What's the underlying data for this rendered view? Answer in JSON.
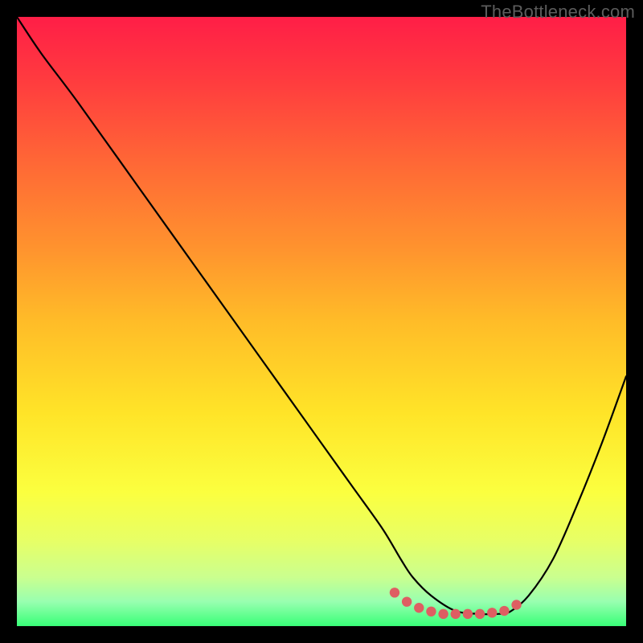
{
  "watermark": "TheBottleneck.com",
  "colors": {
    "background": "#000000",
    "curve": "#000000",
    "dot_fill": "#de5e62",
    "gradient_top": "#ff1e47",
    "gradient_bottom": "#38ff77"
  },
  "chart_data": {
    "type": "line",
    "title": "",
    "xlabel": "",
    "ylabel": "",
    "xlim": [
      0,
      100
    ],
    "ylim": [
      0,
      100
    ],
    "grid": false,
    "legend": false,
    "note": "No axes, ticks, or numeric labels are rendered; values are visual estimates on a 0–100 canvas scale, y increasing downward as drawn.",
    "series": [
      {
        "name": "bottleneck-curve",
        "x": [
          0,
          4,
          10,
          20,
          30,
          40,
          50,
          55,
          60,
          63,
          65,
          68,
          72,
          76,
          79,
          81,
          84,
          88,
          92,
          96,
          100
        ],
        "y": [
          0,
          6,
          14,
          28,
          42,
          56,
          70,
          77,
          84,
          89,
          92,
          95,
          97.5,
          98,
          98,
          97.6,
          95,
          89,
          80,
          70,
          59
        ]
      }
    ],
    "highlight_dots": {
      "name": "highlighted-range",
      "x": [
        62,
        64,
        66,
        68,
        70,
        72,
        74,
        76,
        78,
        80,
        82
      ],
      "y": [
        94.5,
        96,
        97,
        97.6,
        98,
        98,
        98,
        98,
        97.8,
        97.5,
        96.5
      ]
    }
  }
}
